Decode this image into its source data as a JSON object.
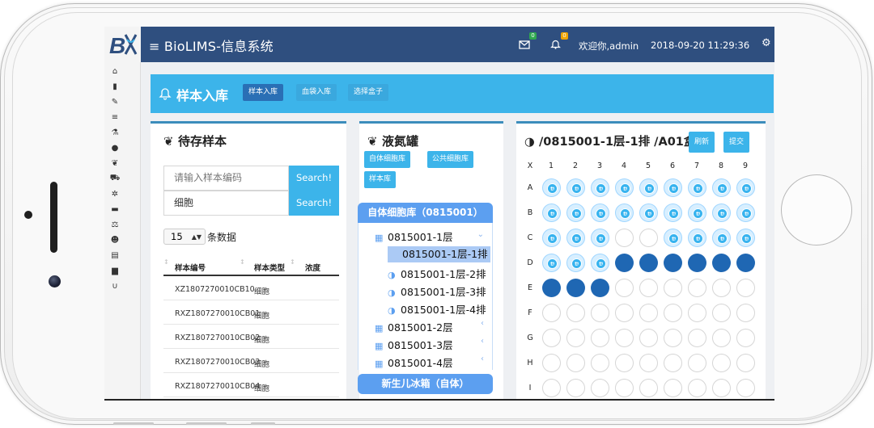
{
  "app": {
    "title": "≡ BioLIMS-信息系统",
    "welcome": "欢迎你,admin",
    "datetime": "2018-09-20 11:29:36",
    "mail_badge": "0",
    "bell_badge": "0"
  },
  "header": {
    "title": "样本入库",
    "buttons": [
      "样本入库",
      "血袋入库",
      "选择盒子"
    ]
  },
  "pending": {
    "title": "待存样本",
    "search1": {
      "placeholder": "请输入样本编码",
      "button": "Search!"
    },
    "search2": {
      "value": "细胞",
      "button": "Search!"
    },
    "page_size": "15",
    "page_size_label": "条数据",
    "columns": [
      "样本编号",
      "样本类型",
      "浓度"
    ],
    "rows": [
      [
        "XZ1807270010CB10",
        "细胞"
      ],
      [
        "RXZ1807270010CB01",
        "细胞"
      ],
      [
        "RXZ1807270010CB02",
        "细胞"
      ],
      [
        "RXZ1807270010CB03",
        "细胞"
      ],
      [
        "RXZ1807270010CB04",
        "细胞"
      ]
    ]
  },
  "tank": {
    "title": "液氮罐",
    "buttons": [
      "自体细胞库",
      "公共细胞库",
      "样本库"
    ],
    "tree_head": "自体细胞库（0815001）",
    "items": [
      "0815001-1层",
      "0815001-1层-1排",
      "0815001-1层-2排",
      "0815001-1层-3排",
      "0815001-1层-4排",
      "0815001-2层",
      "0815001-3层",
      "0815001-4层"
    ],
    "tree_foot": "新生儿冰箱（自体）"
  },
  "box": {
    "title": "/0815001-1层-1排 /A01盒",
    "refresh": "刷新",
    "submit": "提交",
    "corner": "X",
    "cols": [
      "1",
      "2",
      "3",
      "4",
      "5",
      "6",
      "7",
      "8",
      "9"
    ],
    "rows": [
      "A",
      "B",
      "C",
      "D",
      "E",
      "F",
      "G",
      "H",
      "I"
    ],
    "wells": [
      "sssssssss",
      "sssssssss",
      "ssseessss",
      "sssffffff",
      "fffeeeeee",
      "eeeeeeeee",
      "eeeeeeeee",
      "eeeeeeeee",
      "eeeeeeeee"
    ]
  },
  "colors": {
    "nav": "#2f4f7f",
    "accent": "#3cb4ea",
    "tree": "#5c9ff0",
    "filled": "#1f67b3"
  }
}
